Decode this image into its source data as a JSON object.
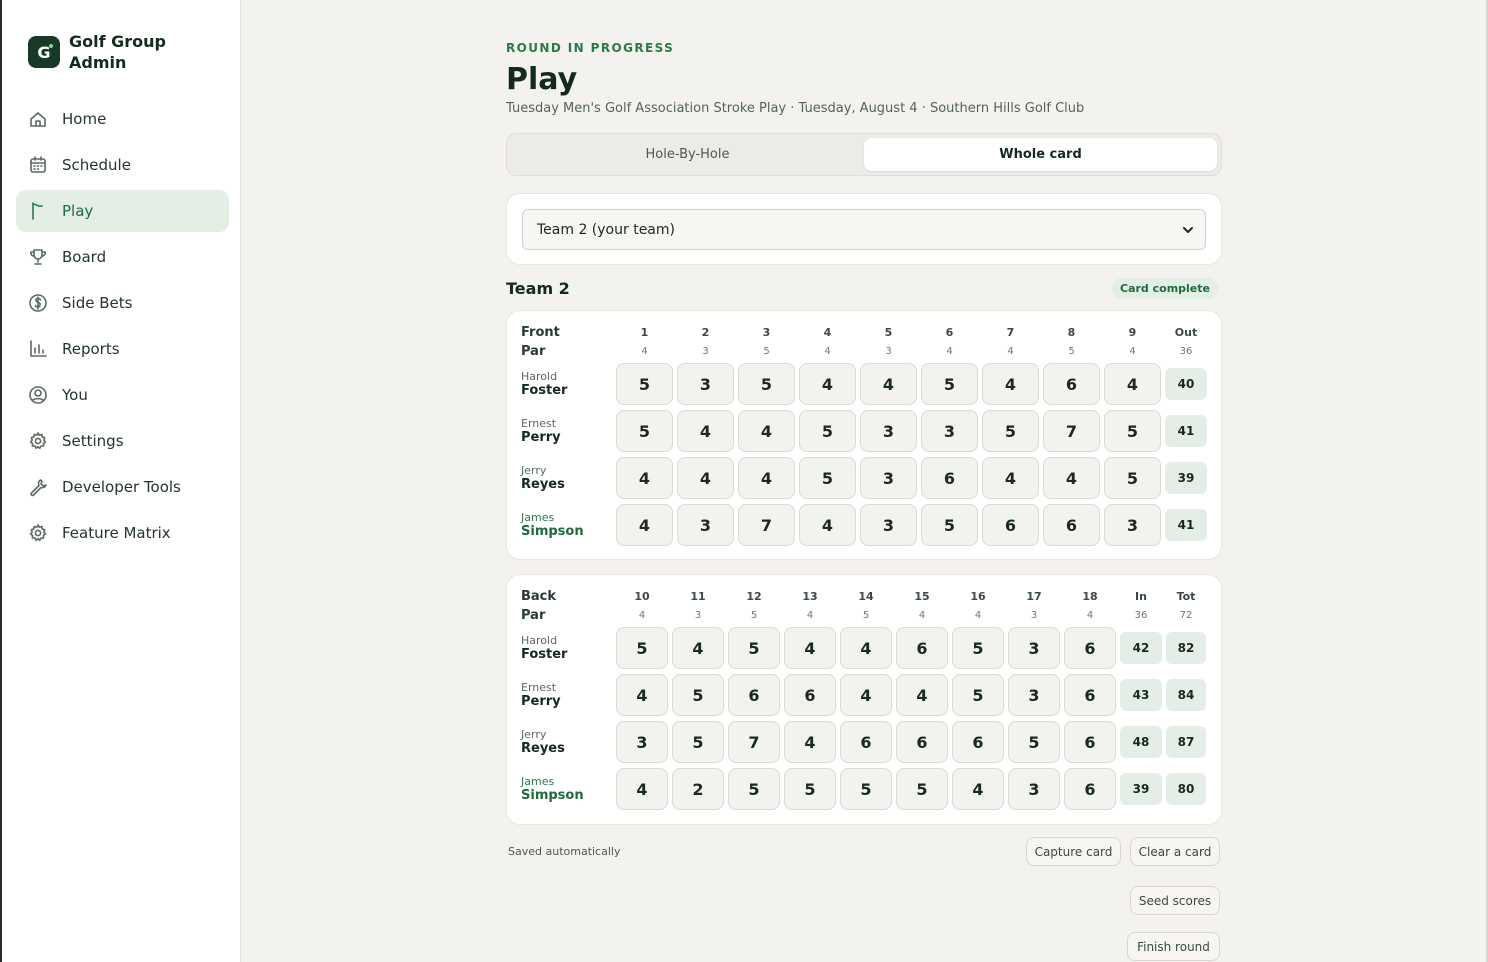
{
  "app": {
    "title": "Golf Group Admin",
    "logo_letter": "G"
  },
  "nav": [
    {
      "label": "Home",
      "icon": "home-icon",
      "active": false
    },
    {
      "label": "Schedule",
      "icon": "calendar-icon",
      "active": false
    },
    {
      "label": "Play",
      "icon": "flag-icon",
      "active": true
    },
    {
      "label": "Board",
      "icon": "trophy-icon",
      "active": false
    },
    {
      "label": "Side Bets",
      "icon": "dollar-icon",
      "active": false
    },
    {
      "label": "Reports",
      "icon": "bar-chart-icon",
      "active": false
    },
    {
      "label": "You",
      "icon": "user-icon",
      "active": false
    },
    {
      "label": "Settings",
      "icon": "gear-icon",
      "active": false
    },
    {
      "label": "Developer Tools",
      "icon": "wrench-icon",
      "active": false
    },
    {
      "label": "Feature Matrix",
      "icon": "gear-icon",
      "active": false
    }
  ],
  "header": {
    "eyebrow": "ROUND IN PROGRESS",
    "title": "Play",
    "subtitle": "Tuesday Men's Golf Association Stroke Play · Tuesday, August 4 · Southern Hills Golf Club"
  },
  "tabs": [
    {
      "label": "Hole-By-Hole",
      "active": false
    },
    {
      "label": "Whole card",
      "active": true
    }
  ],
  "team_select": {
    "value": "Team 2 (your team)"
  },
  "team": {
    "name": "Team 2",
    "status": "Card complete"
  },
  "front": {
    "label": "Front",
    "par_label": "Par",
    "holes": [
      "1",
      "2",
      "3",
      "4",
      "5",
      "6",
      "7",
      "8",
      "9"
    ],
    "total_label": "Out",
    "pars": [
      "4",
      "3",
      "5",
      "4",
      "3",
      "4",
      "4",
      "5",
      "4"
    ],
    "par_total": "36",
    "players": [
      {
        "first": "Harold",
        "last": "Foster",
        "me": false,
        "scores": [
          "5",
          "3",
          "5",
          "4",
          "4",
          "5",
          "4",
          "6",
          "4"
        ],
        "total": "40"
      },
      {
        "first": "Ernest",
        "last": "Perry",
        "me": false,
        "scores": [
          "5",
          "4",
          "4",
          "5",
          "3",
          "3",
          "5",
          "7",
          "5"
        ],
        "total": "41"
      },
      {
        "first": "Jerry",
        "last": "Reyes",
        "me": false,
        "scores": [
          "4",
          "4",
          "4",
          "5",
          "3",
          "6",
          "4",
          "4",
          "5"
        ],
        "total": "39"
      },
      {
        "first": "James",
        "last": "Simpson",
        "me": true,
        "scores": [
          "4",
          "3",
          "7",
          "4",
          "3",
          "5",
          "6",
          "6",
          "3"
        ],
        "total": "41"
      }
    ]
  },
  "back": {
    "label": "Back",
    "par_label": "Par",
    "holes": [
      "10",
      "11",
      "12",
      "13",
      "14",
      "15",
      "16",
      "17",
      "18"
    ],
    "in_label": "In",
    "tot_label": "Tot",
    "pars": [
      "4",
      "3",
      "5",
      "4",
      "5",
      "4",
      "4",
      "3",
      "4"
    ],
    "par_in": "36",
    "par_tot": "72",
    "players": [
      {
        "first": "Harold",
        "last": "Foster",
        "me": false,
        "scores": [
          "5",
          "4",
          "5",
          "4",
          "4",
          "6",
          "5",
          "3",
          "6"
        ],
        "in": "42",
        "tot": "82"
      },
      {
        "first": "Ernest",
        "last": "Perry",
        "me": false,
        "scores": [
          "4",
          "5",
          "6",
          "6",
          "4",
          "4",
          "5",
          "3",
          "6"
        ],
        "in": "43",
        "tot": "84"
      },
      {
        "first": "Jerry",
        "last": "Reyes",
        "me": false,
        "scores": [
          "3",
          "5",
          "7",
          "4",
          "6",
          "6",
          "6",
          "5",
          "6"
        ],
        "in": "48",
        "tot": "87"
      },
      {
        "first": "James",
        "last": "Simpson",
        "me": true,
        "scores": [
          "4",
          "2",
          "5",
          "5",
          "5",
          "5",
          "4",
          "3",
          "6"
        ],
        "in": "39",
        "tot": "80"
      }
    ]
  },
  "footer": {
    "saved_note": "Saved automatically",
    "capture_label": "Capture card",
    "clear_label": "Clear a card",
    "seed_label": "Seed scores",
    "finish_label": "Finish round"
  }
}
